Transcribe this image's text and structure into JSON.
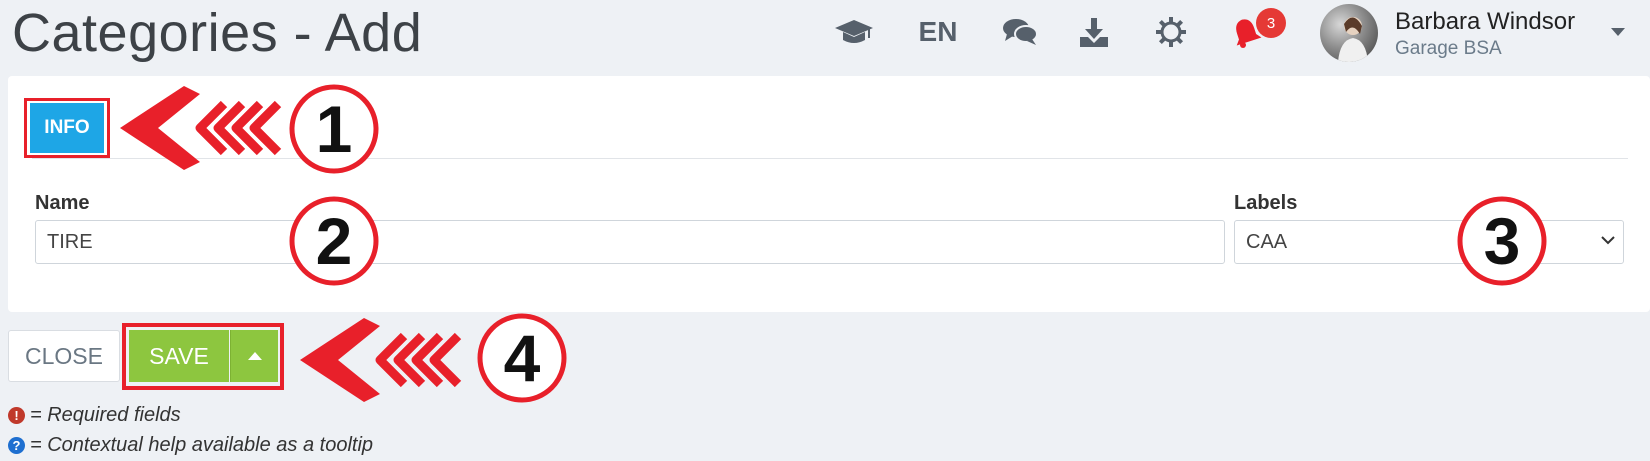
{
  "header": {
    "title": "Categories - Add",
    "language": "EN",
    "notification_count": "3",
    "icons": [
      "graduation-cap-icon",
      "chat-icon",
      "download-icon",
      "gear-icon",
      "bell-icon",
      "chevron-down-icon"
    ],
    "user": {
      "name": "Barbara Windsor",
      "company": "Garage BSA"
    }
  },
  "tabs": [
    {
      "label": "INFO",
      "active": true
    }
  ],
  "form": {
    "name": {
      "label": "Name",
      "value": "TIRE"
    },
    "labels": {
      "label": "Labels",
      "selected": "CAA"
    }
  },
  "actions": {
    "close_label": "CLOSE",
    "save_label": "SAVE"
  },
  "legend": {
    "required": "= Required fields",
    "help": "= Contextual help available as a tooltip"
  },
  "annotations": [
    "1",
    "2",
    "3",
    "4"
  ],
  "colors": {
    "accent_blue": "#1ea6e6",
    "save_green": "#8dc63f",
    "annotation_red": "#e8202a",
    "badge_red": "#e53935"
  }
}
